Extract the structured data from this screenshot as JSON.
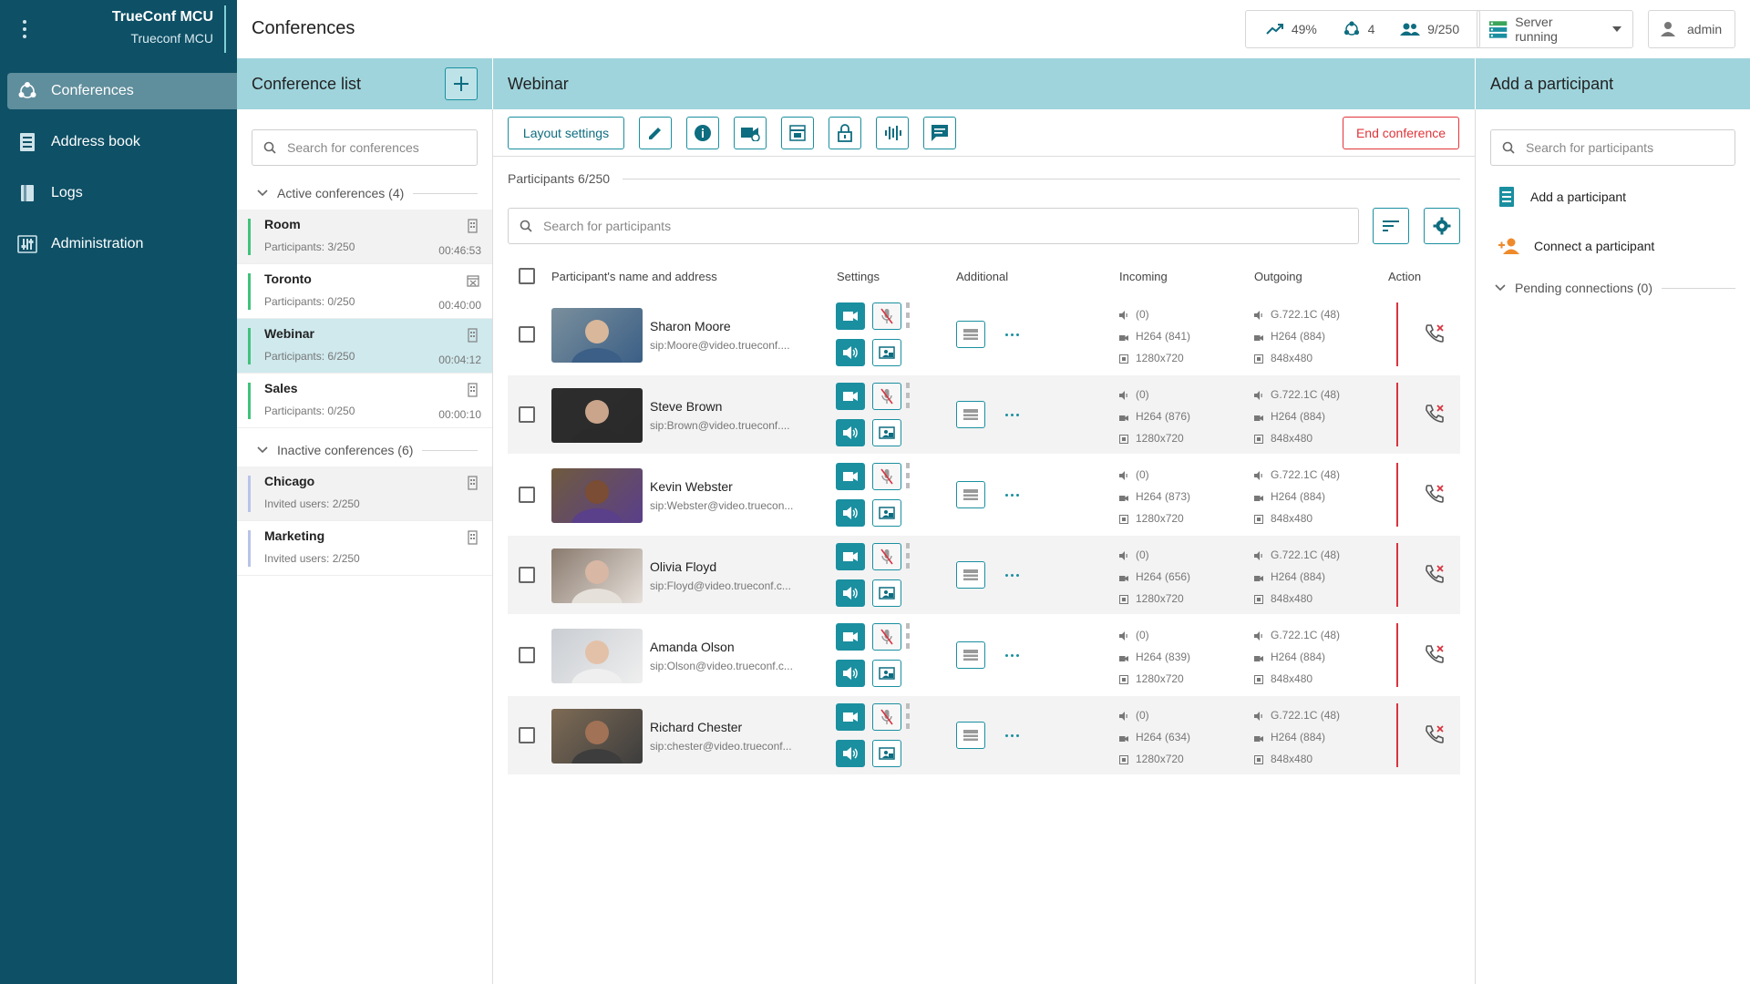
{
  "sidebar": {
    "brand_title": "TrueConf MCU",
    "brand_subtitle": "Trueconf MCU",
    "items": [
      {
        "label": "Conferences",
        "icon": "conferences-icon",
        "active": true
      },
      {
        "label": "Address book",
        "icon": "address-book-icon"
      },
      {
        "label": "Logs",
        "icon": "logs-icon"
      },
      {
        "label": "Administration",
        "icon": "administration-icon"
      }
    ]
  },
  "header": {
    "title": "Conferences",
    "stats": {
      "cpu": "49%",
      "conferences": "4",
      "participants": "9/250"
    },
    "server_status": "Server running",
    "user": "admin"
  },
  "conference_list": {
    "title": "Conference list",
    "search_placeholder": "Search for conferences",
    "active_group": "Active conferences (4)",
    "inactive_group": "Inactive conferences (6)",
    "active": [
      {
        "name": "Room",
        "info": "Participants: 3/250",
        "time": "00:46:53"
      },
      {
        "name": "Toronto",
        "info": "Participants: 0/250",
        "time": "00:40:00"
      },
      {
        "name": "Webinar",
        "info": "Participants: 6/250",
        "time": "00:04:12"
      },
      {
        "name": "Sales",
        "info": "Participants: 0/250",
        "time": "00:00:10"
      }
    ],
    "inactive": [
      {
        "name": "Chicago",
        "info": "Invited users: 2/250"
      },
      {
        "name": "Marketing",
        "info": "Invited users: 2/250"
      }
    ]
  },
  "conference": {
    "title": "Webinar",
    "layout_settings": "Layout settings",
    "end_conference": "End conference",
    "participants_count": "Participants 6/250",
    "search_placeholder": "Search for participants",
    "columns": {
      "name": "Participant's name and address",
      "settings": "Settings",
      "additional": "Additional",
      "incoming": "Incoming",
      "outgoing": "Outgoing",
      "action": "Action"
    },
    "participants": [
      {
        "name": "Sharon Moore",
        "address": "sip:Moore@video.trueconf....",
        "in_audio": "(0)",
        "in_video": "H264 (841)",
        "in_res": "1280x720",
        "out_audio": "G.722.1C (48)",
        "out_video": "H264 (884)",
        "out_res": "848x480"
      },
      {
        "name": "Steve Brown",
        "address": "sip:Brown@video.trueconf....",
        "in_audio": "(0)",
        "in_video": "H264 (876)",
        "in_res": "1280x720",
        "out_audio": "G.722.1C (48)",
        "out_video": "H264 (884)",
        "out_res": "848x480"
      },
      {
        "name": "Kevin Webster",
        "address": "sip:Webster@video.truecon...",
        "in_audio": "(0)",
        "in_video": "H264 (873)",
        "in_res": "1280x720",
        "out_audio": "G.722.1C (48)",
        "out_video": "H264 (884)",
        "out_res": "848x480"
      },
      {
        "name": "Olivia Floyd",
        "address": "sip:Floyd@video.trueconf.c...",
        "in_audio": "(0)",
        "in_video": "H264 (656)",
        "in_res": "1280x720",
        "out_audio": "G.722.1C (48)",
        "out_video": "H264 (884)",
        "out_res": "848x480"
      },
      {
        "name": "Amanda Olson",
        "address": "sip:Olson@video.trueconf.c...",
        "in_audio": "(0)",
        "in_video": "H264 (839)",
        "in_res": "1280x720",
        "out_audio": "G.722.1C (48)",
        "out_video": "H264 (884)",
        "out_res": "848x480"
      },
      {
        "name": "Richard Chester",
        "address": "sip:chester@video.trueconf...",
        "in_audio": "(0)",
        "in_video": "H264 (634)",
        "in_res": "1280x720",
        "out_audio": "G.722.1C (48)",
        "out_video": "H264 (884)",
        "out_res": "848x480"
      }
    ]
  },
  "add_participant": {
    "title": "Add a participant",
    "search_placeholder": "Search for participants",
    "add_label": "Add a participant",
    "connect_label": "Connect a participant",
    "pending": "Pending connections (0)"
  },
  "colors": {
    "sidebar": "#0e5066",
    "accent": "#1a8fa0",
    "header_band": "#9fd4dc",
    "danger": "#e0353a",
    "active_green": "#41c27a"
  }
}
